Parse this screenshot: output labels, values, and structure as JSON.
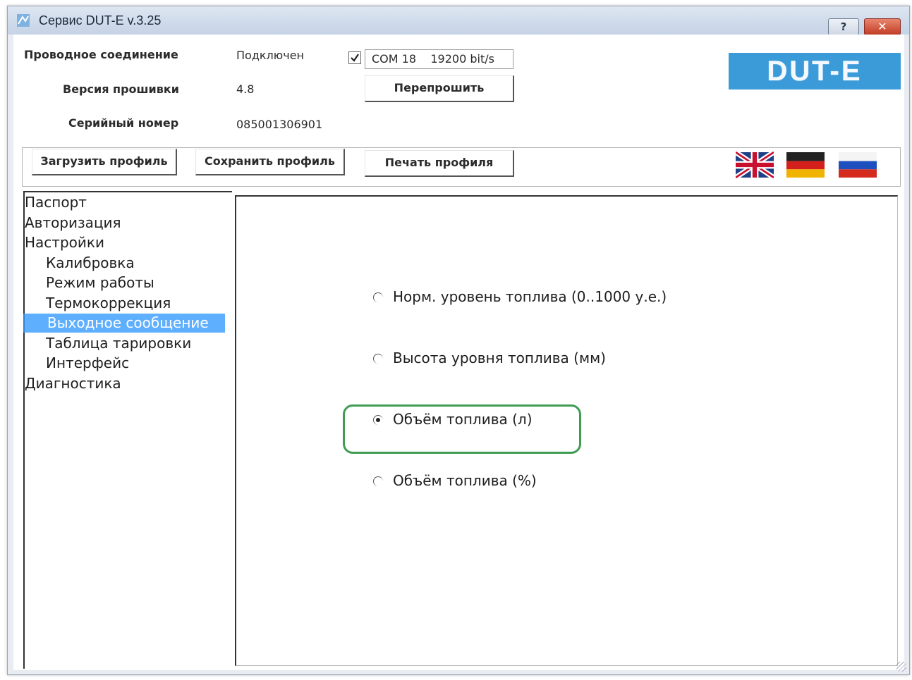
{
  "window": {
    "title": "Сервис DUT-E  v.3.25",
    "help_label": "?",
    "close_label": "✕"
  },
  "info": {
    "connection_label": "Проводное соединение",
    "connection_status": "Подключен",
    "connection_checked": true,
    "port": "COM 18    19200 bit/s",
    "firmware_label": "Версия прошивки",
    "firmware_value": "4.8",
    "reflash_button": "Перепрошить",
    "serial_label": "Серийный номер",
    "serial_value": "085001306901"
  },
  "logo": {
    "text": "DUT-E",
    "color": "#3b9bd9"
  },
  "toolbar": {
    "load_profile": "Загрузить профиль",
    "save_profile": "Сохранить профиль",
    "print_profile": "Печать профиля",
    "languages": [
      "english-flag-icon",
      "german-flag-icon",
      "russian-flag-icon"
    ]
  },
  "nav": {
    "items": [
      {
        "label": "Паспорт",
        "level": 0
      },
      {
        "label": "Авторизация",
        "level": 0
      },
      {
        "label": "Настройки",
        "level": 0
      },
      {
        "label": "Калибровка",
        "level": 1
      },
      {
        "label": "Режим работы",
        "level": 1
      },
      {
        "label": "Термокоррекция",
        "level": 1
      },
      {
        "label": "Выходное сообщение",
        "level": 1,
        "selected": true
      },
      {
        "label": "Таблица тарировки",
        "level": 1
      },
      {
        "label": "Интерфейс",
        "level": 1
      },
      {
        "label": "Диагностика",
        "level": 0
      }
    ],
    "selected_color": "#3399ff"
  },
  "output_message": {
    "options": [
      {
        "label": "Норм. уровень топлива (0..1000 у.е.)",
        "selected": false
      },
      {
        "label": "Высота уровня топлива  (мм)",
        "selected": false
      },
      {
        "label": "Объём топлива  (л)",
        "selected": true
      },
      {
        "label": "Объём топлива  (%)",
        "selected": false
      }
    ],
    "highlight_color": "#3f9c52"
  }
}
